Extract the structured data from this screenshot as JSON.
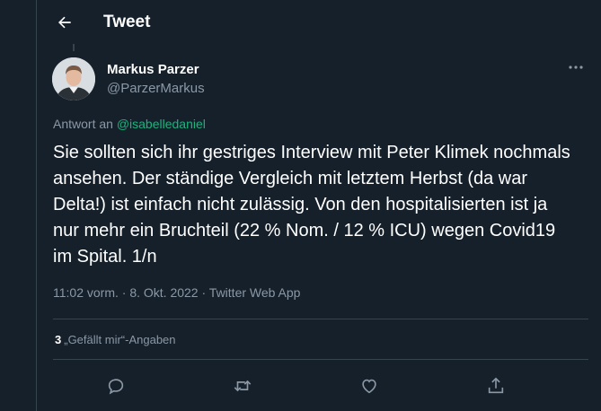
{
  "header": {
    "title": "Tweet",
    "back_icon": "arrow-left-icon"
  },
  "author": {
    "name": "Markus Parzer",
    "handle": "@ParzerMarkus"
  },
  "reply": {
    "prefix": "Antwort an",
    "handle": "@isabelledaniel"
  },
  "tweet": {
    "text": "Sie sollten sich ihr gestriges Interview mit Peter Klimek nochmals ansehen. Der ständige Vergleich mit letztem Herbst (da war Delta!) ist einfach nicht zulässig. Von den hospitalisierten ist ja nur mehr ein Bruchteil (22 % Nom. / 12 % ICU) wegen Covid19 im Spital. 1/n",
    "meta": "11:02 vorm. · 8. Okt. 2022 · Twitter Web App"
  },
  "stats": {
    "likes_count": "3",
    "likes_label": "„Gefällt mir“-Angaben"
  },
  "actions": {
    "reply_icon": "reply-icon",
    "retweet_icon": "retweet-icon",
    "like_icon": "heart-icon",
    "share_icon": "share-icon"
  },
  "colors": {
    "background": "#15202b",
    "border": "#38444d",
    "secondary_text": "#8b98a5",
    "mention": "#19b57b"
  }
}
